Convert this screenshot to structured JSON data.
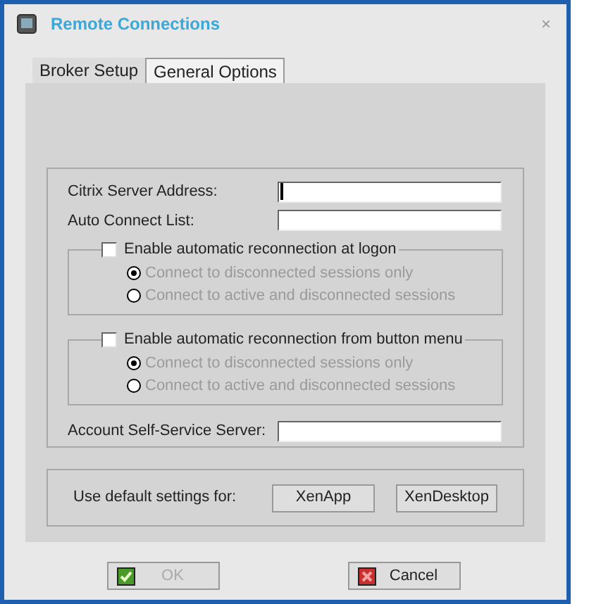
{
  "window": {
    "title": "Remote Connections",
    "close": "×"
  },
  "tabs": [
    {
      "label": "Broker Setup",
      "selected": true
    },
    {
      "label": "General Options",
      "selected": false
    }
  ],
  "fields": [
    {
      "label": "Citrix Server Address:",
      "focused": true
    },
    {
      "label": "Auto Connect List:",
      "focused": false
    }
  ],
  "groups": [
    {
      "label": "Enable automatic reconnection at logon",
      "checked": false,
      "options": [
        {
          "label": "Connect to disconnected sessions only",
          "selected": true,
          "disabled": true
        },
        {
          "label": "Connect to active and disconnected sessions",
          "selected": false,
          "disabled": true
        }
      ]
    },
    {
      "label": "Enable automatic reconnection from button menu",
      "checked": false,
      "options": [
        {
          "label": "Connect to disconnected sessions only",
          "selected": true,
          "disabled": true
        },
        {
          "label": "Connect to active and disconnected sessions",
          "selected": false,
          "disabled": true
        }
      ]
    }
  ],
  "account_field": {
    "label": "Account Self-Service Server:"
  },
  "defaults": {
    "label": "Use default settings for:",
    "buttons": [
      "XenApp",
      "XenDesktop"
    ]
  },
  "buttons": [
    {
      "label": "OK",
      "kind": "ok",
      "disabled": true
    },
    {
      "label": "Cancel",
      "kind": "cancel",
      "disabled": false
    }
  ]
}
